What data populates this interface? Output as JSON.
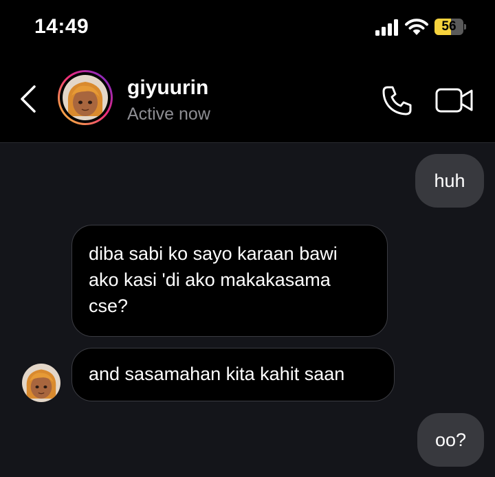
{
  "status_bar": {
    "time": "14:49",
    "battery_level": "56",
    "battery_fraction": 0.56,
    "icons": [
      "signal-icon",
      "wifi-icon",
      "battery-icon"
    ]
  },
  "header": {
    "contact_name": "giyuurin",
    "contact_status": "Active now",
    "icons": [
      "back-chevron-icon",
      "phone-icon",
      "video-camera-icon"
    ],
    "story_ring_colors": [
      "#f9ce34",
      "#ee2a7b",
      "#6228d7"
    ]
  },
  "messages": [
    {
      "direction": "sent",
      "text": "huh"
    },
    {
      "direction": "received",
      "text": "diba sabi ko sayo karaan bawi ako kasi 'di ako makakasama cse?"
    },
    {
      "direction": "received",
      "text": "and sasamahan kita kahit saan"
    },
    {
      "direction": "sent",
      "text": "oo?"
    }
  ],
  "colors": {
    "background": "#000000",
    "chat_background": "#14151a",
    "sent_bubble": "#38393e",
    "received_bubble": "#000000",
    "received_border": "#3b3c42",
    "secondary_text": "#8e8e93",
    "battery_accent": "#f7d33d"
  }
}
